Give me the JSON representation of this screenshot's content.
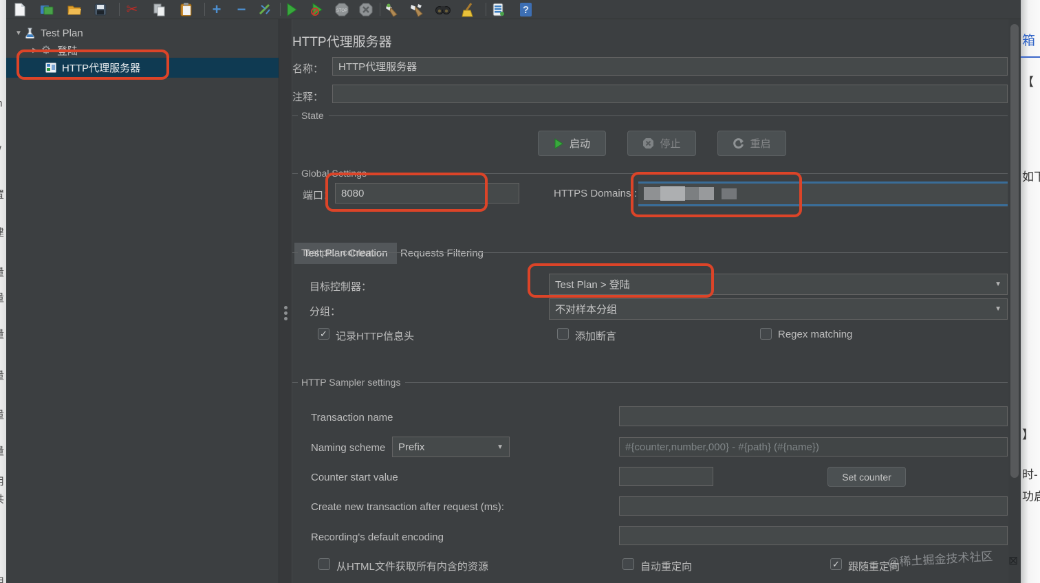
{
  "toolbar": {
    "icons": [
      "new-file",
      "templates",
      "open",
      "save",
      "cut",
      "copy",
      "paste",
      "expand-all",
      "collapse-all",
      "toggle",
      "start",
      "start-no-pauses",
      "stop",
      "shutdown",
      "clear",
      "clear-all",
      "search",
      "reset-search",
      "function-helper",
      "help"
    ]
  },
  "tree": {
    "items": [
      {
        "label": "Test Plan"
      },
      {
        "label": "登陆"
      },
      {
        "label": "HTTP代理服务器"
      }
    ]
  },
  "main": {
    "title": "HTTP代理服务器",
    "name_label": "名称：",
    "name_value": "HTTP代理服务器",
    "comment_label": "注释：",
    "comment_value": "",
    "state": {
      "title": "State",
      "start": "启动",
      "stop": "停止",
      "restart": "重启"
    },
    "global": {
      "title": "Global Settings",
      "port_label": "端口：",
      "port_value": "8080",
      "https_label": "HTTPS Domains :"
    },
    "tabs": {
      "creation": "Test Plan Creation",
      "filtering": "Requests Filtering"
    },
    "content": {
      "title": "Test plan content",
      "target_label": "目标控制器：",
      "target_value": "Test Plan > 登陆",
      "grouping_label": "分组：",
      "grouping_value": "不对样本分组",
      "cb_headers": "记录HTTP信息头",
      "cb_assertion": "添加断言",
      "cb_regex": "Regex matching"
    },
    "sampler": {
      "title": "HTTP Sampler settings",
      "transaction_label": "Transaction name",
      "naming_label": "Naming scheme",
      "naming_value": "Prefix",
      "naming_placeholder": "#{counter,number,000} - #{path} (#{name})",
      "counter_label": "Counter start value",
      "set_counter": "Set counter",
      "new_transaction_label": "Create new transaction after request (ms):",
      "encoding_label": "Recording's default encoding",
      "cb_resources": "从HTML文件获取所有内含的资源",
      "cb_auto_redirect": "自动重定向",
      "cb_follow_redirect": "跟随重定向"
    },
    "watermark": "@稀土掘金技术社区"
  },
  "page_edges": {
    "left_chars": [
      "m",
      "w",
      "置",
      "建",
      "量",
      "量",
      "量",
      "量",
      "量",
      "量",
      "用",
      "共",
      "、",
      "用"
    ],
    "right_fragments": [
      "箱",
      "【",
      "如下",
      "】",
      "时-",
      "功启"
    ]
  },
  "colors": {
    "background": "#3c3f41",
    "field": "#45494a",
    "field_border": "#646464",
    "text": "#bdbdbd",
    "selection": "#0f3a52",
    "annotation": "#dc4428",
    "accent_blue": "#3a6d98",
    "tab_selected": "#53575a"
  }
}
